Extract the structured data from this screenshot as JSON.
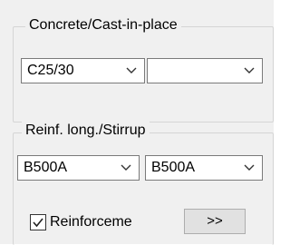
{
  "concrete_group": {
    "title": "Concrete/Cast-in-place",
    "grade_select": {
      "value": "C25/30",
      "icon": "chevron-down-icon"
    },
    "second_select": {
      "value": "",
      "icon": "chevron-down-icon"
    }
  },
  "reinf_group": {
    "title": "Reinf. long./Stirrup",
    "long_select": {
      "value": "B500A",
      "icon": "chevron-down-icon"
    },
    "stirrup_select": {
      "value": "B500A",
      "icon": "chevron-down-icon"
    },
    "reinforcement_checkbox": {
      "label": "Reinforceme",
      "checked": true
    },
    "more_button": {
      "label": ">>"
    }
  }
}
